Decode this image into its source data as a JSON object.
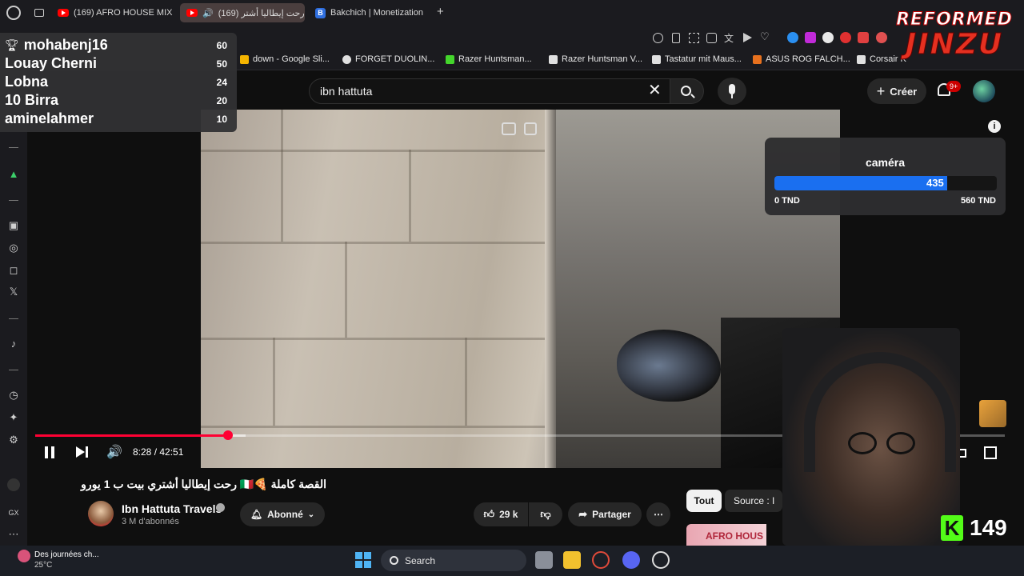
{
  "browser": {
    "tabs": [
      {
        "label": "(169) AFRO HOUSE MIX W",
        "favicon": "youtube-icon",
        "active": false
      },
      {
        "label": "(169) رحت إيطاليا أشتر",
        "favicon": "youtube-icon",
        "active": true
      },
      {
        "label": "Bakchich | Monetization",
        "favicon": "bakchich-icon",
        "active": false
      }
    ],
    "new_tab": "+",
    "bookmarks": [
      {
        "label": "down - Google Sli...",
        "color": "#f4b400"
      },
      {
        "label": "FORGET DUOLIN...",
        "color": "#e0e0e0"
      },
      {
        "label": "Razer Huntsman...",
        "color": "#44d62c"
      },
      {
        "label": "Razer Huntsman V...",
        "color": "#e0e0e0"
      },
      {
        "label": "Tastatur mit Maus...",
        "color": "#e0e0e0"
      },
      {
        "label": "ASUS ROG FALCH...",
        "color": "#e8711e"
      },
      {
        "label": "Corsair K",
        "color": "#e0e0e0"
      }
    ]
  },
  "leaderboard": {
    "entries": [
      {
        "name": "mohabenj16",
        "score": "60"
      },
      {
        "name": "Louay Cherni",
        "score": "50"
      },
      {
        "name": "Lobna",
        "score": "24"
      },
      {
        "name": "10 Birra",
        "score": "20"
      },
      {
        "name": "aminelahmer",
        "score": "10"
      }
    ]
  },
  "brand": {
    "line1": "REFORMED",
    "line2": "JINZU"
  },
  "youtube": {
    "search_value": "ibn hattuta",
    "create_label": "Créer",
    "notifications_badge": "9+"
  },
  "goal": {
    "title": "caméra",
    "current": "435",
    "min_label": "0 TND",
    "max_label": "560 TND",
    "progress_fraction": 0.777
  },
  "player": {
    "time": "8:28 / 42:51",
    "progress_fraction": 0.199
  },
  "video": {
    "title": "القصة كاملة 🍕🇮🇹 رحت إيطاليا أشتري بيت ب 1 يورو",
    "channel": "Ibn Hattuta Travels",
    "subscribers": "3 M d'abonnés",
    "subscribed_label": "Abonné",
    "likes": "29 k",
    "share_label": "Partager"
  },
  "chips": {
    "all": "Tout",
    "source": "Source : I"
  },
  "promo": {
    "label": "AFRO HOUS"
  },
  "kick": {
    "viewers": "149"
  },
  "taskbar": {
    "weather_label": "Des journées ch...",
    "weather_temp": "25°C",
    "search_label": "Search"
  }
}
